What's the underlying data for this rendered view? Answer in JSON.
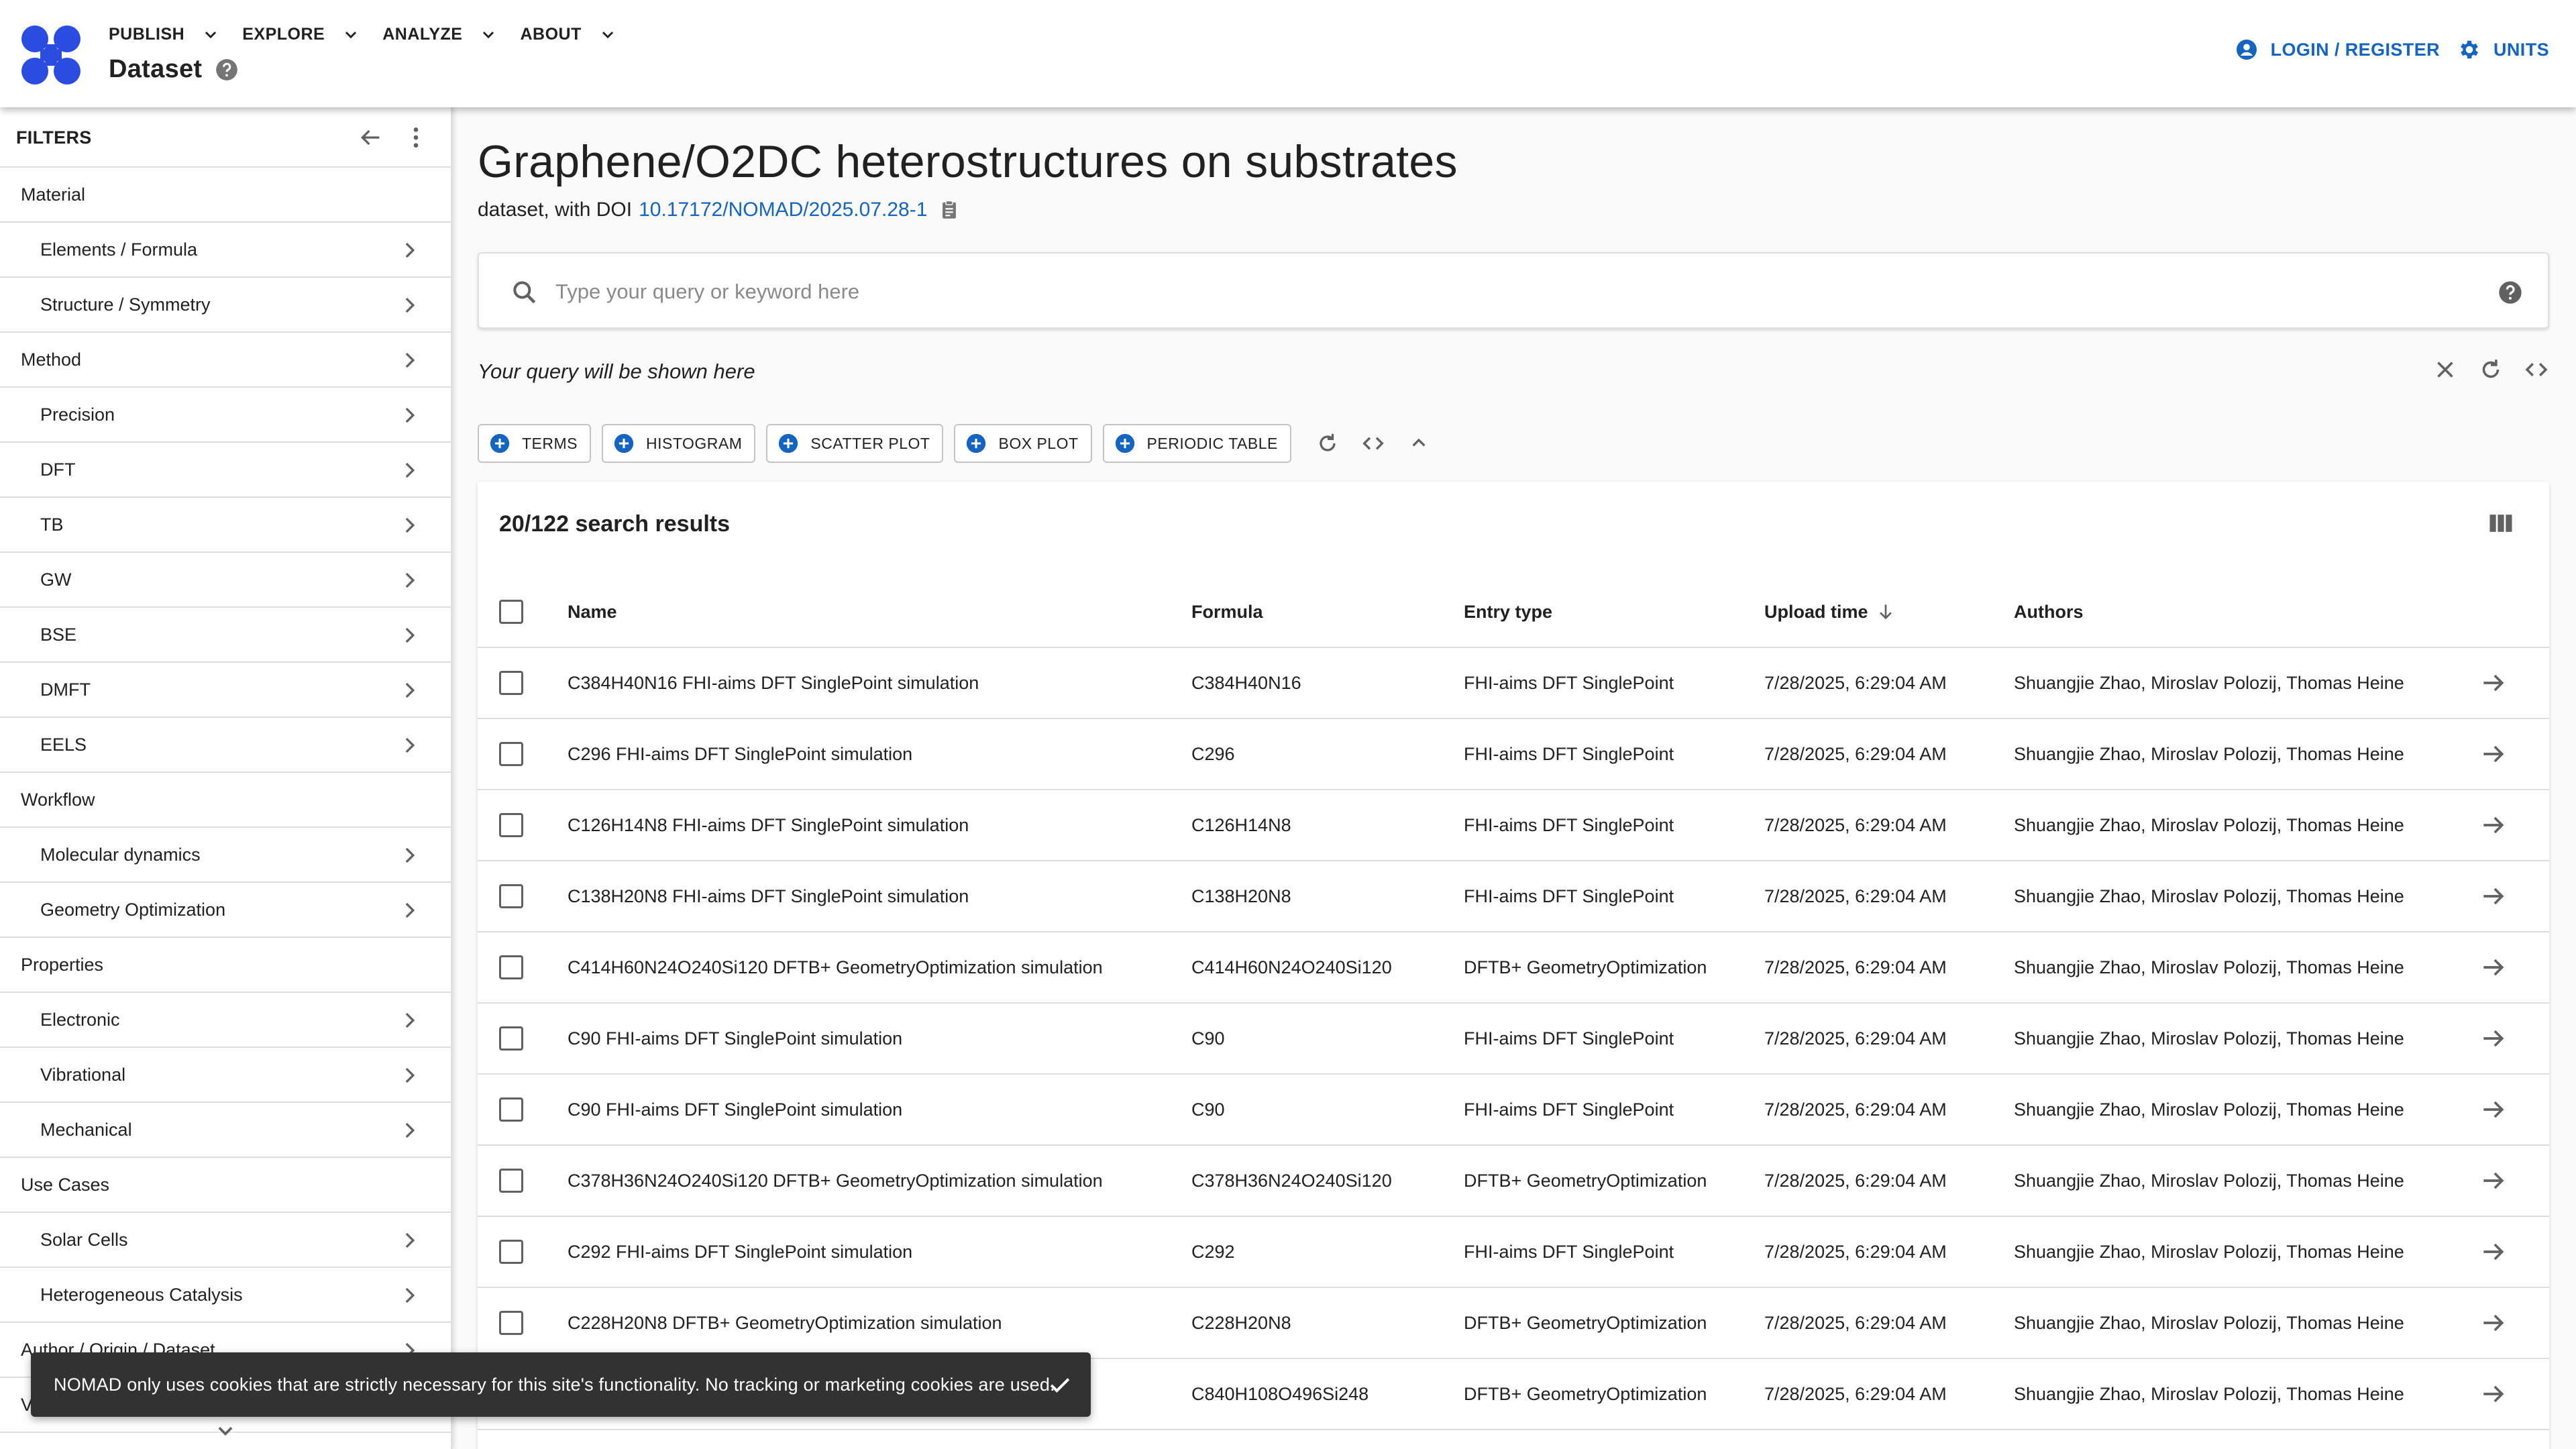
{
  "header": {
    "nav": [
      {
        "label": "PUBLISH"
      },
      {
        "label": "EXPLORE"
      },
      {
        "label": "ANALYZE"
      },
      {
        "label": "ABOUT"
      }
    ],
    "page_title": "Dataset",
    "login_label": "LOGIN / REGISTER",
    "units_label": "UNITS"
  },
  "sidebar": {
    "title": "FILTERS",
    "items": [
      {
        "label": "Material",
        "kind": "category",
        "chevron": false
      },
      {
        "label": "Elements / Formula",
        "kind": "sub",
        "chevron": true
      },
      {
        "label": "Structure / Symmetry",
        "kind": "sub",
        "chevron": true
      },
      {
        "label": "Method",
        "kind": "category",
        "chevron": true
      },
      {
        "label": "Precision",
        "kind": "sub",
        "chevron": true
      },
      {
        "label": "DFT",
        "kind": "sub",
        "chevron": true
      },
      {
        "label": "TB",
        "kind": "sub",
        "chevron": true
      },
      {
        "label": "GW",
        "kind": "sub",
        "chevron": true
      },
      {
        "label": "BSE",
        "kind": "sub",
        "chevron": true
      },
      {
        "label": "DMFT",
        "kind": "sub",
        "chevron": true
      },
      {
        "label": "EELS",
        "kind": "sub",
        "chevron": true
      },
      {
        "label": "Workflow",
        "kind": "category",
        "chevron": false
      },
      {
        "label": "Molecular dynamics",
        "kind": "sub",
        "chevron": true
      },
      {
        "label": "Geometry Optimization",
        "kind": "sub",
        "chevron": true
      },
      {
        "label": "Properties",
        "kind": "category",
        "chevron": false
      },
      {
        "label": "Electronic",
        "kind": "sub",
        "chevron": true
      },
      {
        "label": "Vibrational",
        "kind": "sub",
        "chevron": true
      },
      {
        "label": "Mechanical",
        "kind": "sub",
        "chevron": true
      },
      {
        "label": "Use Cases",
        "kind": "category",
        "chevron": false
      },
      {
        "label": "Solar Cells",
        "kind": "sub",
        "chevron": true
      },
      {
        "label": "Heterogeneous Catalysis",
        "kind": "sub",
        "chevron": true
      },
      {
        "label": "Author / Origin / Dataset",
        "kind": "category",
        "chevron": true
      },
      {
        "label": "Visibility",
        "kind": "category",
        "chevron": true
      }
    ]
  },
  "dataset": {
    "title": "Graphene/O2DC heterostructures on substrates",
    "subtitle_prefix": "dataset, with DOI",
    "doi": "10.17172/NOMAD/2025.07.28-1"
  },
  "search": {
    "placeholder": "Type your query or keyword here",
    "query_text": "Your query will be shown here"
  },
  "widgets": [
    {
      "label": "TERMS"
    },
    {
      "label": "HISTOGRAM"
    },
    {
      "label": "SCATTER PLOT"
    },
    {
      "label": "BOX PLOT"
    },
    {
      "label": "PERIODIC TABLE"
    }
  ],
  "results": {
    "count_text": "20/122 search results",
    "columns": {
      "name": "Name",
      "formula": "Formula",
      "entry_type": "Entry type",
      "upload_time": "Upload time",
      "authors": "Authors"
    },
    "rows": [
      {
        "name": "C384H40N16 FHI-aims DFT SinglePoint simulation",
        "formula": "C384H40N16",
        "entry_type": "FHI-aims DFT SinglePoint",
        "upload_time": "7/28/2025, 6:29:04 AM",
        "authors": "Shuangjie Zhao, Miroslav Polozij, Thomas Heine"
      },
      {
        "name": "C296 FHI-aims DFT SinglePoint simulation",
        "formula": "C296",
        "entry_type": "FHI-aims DFT SinglePoint",
        "upload_time": "7/28/2025, 6:29:04 AM",
        "authors": "Shuangjie Zhao, Miroslav Polozij, Thomas Heine"
      },
      {
        "name": "C126H14N8 FHI-aims DFT SinglePoint simulation",
        "formula": "C126H14N8",
        "entry_type": "FHI-aims DFT SinglePoint",
        "upload_time": "7/28/2025, 6:29:04 AM",
        "authors": "Shuangjie Zhao, Miroslav Polozij, Thomas Heine"
      },
      {
        "name": "C138H20N8 FHI-aims DFT SinglePoint simulation",
        "formula": "C138H20N8",
        "entry_type": "FHI-aims DFT SinglePoint",
        "upload_time": "7/28/2025, 6:29:04 AM",
        "authors": "Shuangjie Zhao, Miroslav Polozij, Thomas Heine"
      },
      {
        "name": "C414H60N24O240Si120 DFTB+ GeometryOptimization simulation",
        "formula": "C414H60N24O240Si120",
        "entry_type": "DFTB+ GeometryOptimization",
        "upload_time": "7/28/2025, 6:29:04 AM",
        "authors": "Shuangjie Zhao, Miroslav Polozij, Thomas Heine"
      },
      {
        "name": "C90 FHI-aims DFT SinglePoint simulation",
        "formula": "C90",
        "entry_type": "FHI-aims DFT SinglePoint",
        "upload_time": "7/28/2025, 6:29:04 AM",
        "authors": "Shuangjie Zhao, Miroslav Polozij, Thomas Heine"
      },
      {
        "name": "C90 FHI-aims DFT SinglePoint simulation",
        "formula": "C90",
        "entry_type": "FHI-aims DFT SinglePoint",
        "upload_time": "7/28/2025, 6:29:04 AM",
        "authors": "Shuangjie Zhao, Miroslav Polozij, Thomas Heine"
      },
      {
        "name": "C378H36N24O240Si120 DFTB+ GeometryOptimization simulation",
        "formula": "C378H36N24O240Si120",
        "entry_type": "DFTB+ GeometryOptimization",
        "upload_time": "7/28/2025, 6:29:04 AM",
        "authors": "Shuangjie Zhao, Miroslav Polozij, Thomas Heine"
      },
      {
        "name": "C292 FHI-aims DFT SinglePoint simulation",
        "formula": "C292",
        "entry_type": "FHI-aims DFT SinglePoint",
        "upload_time": "7/28/2025, 6:29:04 AM",
        "authors": "Shuangjie Zhao, Miroslav Polozij, Thomas Heine"
      },
      {
        "name": "C228H20N8 DFTB+ GeometryOptimization simulation",
        "formula": "C228H20N8",
        "entry_type": "DFTB+ GeometryOptimization",
        "upload_time": "7/28/2025, 6:29:04 AM",
        "authors": "Shuangjie Zhao, Miroslav Polozij, Thomas Heine"
      },
      {
        "name": "",
        "formula": "C840H108O496Si248",
        "entry_type": "DFTB+ GeometryOptimization",
        "upload_time": "7/28/2025, 6:29:04 AM",
        "authors": "Shuangjie Zhao, Miroslav Polozij, Thomas Heine"
      }
    ]
  },
  "cookie_banner": {
    "message": "NOMAD only uses cookies that are strictly necessary for this site's functionality. No tracking or marketing cookies are used."
  },
  "colors": {
    "accent": "#1565c0",
    "logo": "#2a4cdf",
    "text": "#212121",
    "snackbar": "#323232"
  },
  "icons": [
    "nomad-logo",
    "chevron-down-icon",
    "help-icon",
    "account-circle-icon",
    "gear-icon",
    "arrow-back-icon",
    "more-vert-icon",
    "chevron-right-icon",
    "search-icon",
    "close-icon",
    "reset-icon",
    "code-icon",
    "add-circle-icon",
    "chevron-up-icon",
    "view-columns-icon",
    "arrow-down-icon",
    "arrow-forward-icon",
    "check-icon",
    "clipboard-icon"
  ]
}
